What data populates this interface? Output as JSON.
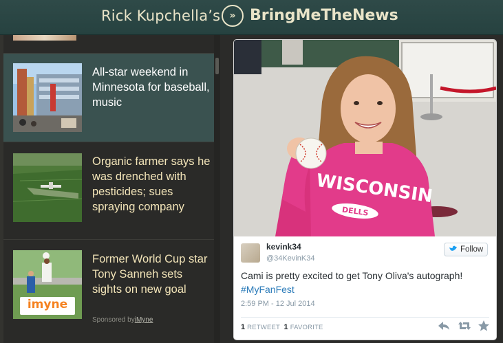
{
  "header": {
    "brand_prefix": "Rick Kupchella’s",
    "logo_glyph": "»",
    "brand_name": "BringMeTheNews"
  },
  "stories": [
    {
      "headline": "All-star weekend in Minnesota for baseball, music",
      "active": true
    },
    {
      "headline": "Organic farmer says he was drenched with pesticides; sues spraying company",
      "active": false
    },
    {
      "headline": "Former World Cup star Tony Sanneh sets sights on new goal",
      "active": false,
      "sponsored_prefix": "Sponsored by",
      "sponsor": "iMyne",
      "thumb_logo": "imyne"
    }
  ],
  "tweet": {
    "name": "kevink34",
    "handle": "@34KevinK34",
    "follow_label": "Follow",
    "text": "Cami is pretty excited to get Tony Oliva's autograph!",
    "hashtag": "#MyFanFest",
    "date": "2:59 PM - 12 Jul 2014",
    "retweets": "1",
    "retweet_label": "RETWEET",
    "favorites": "1",
    "favorite_label": "FAVORITE",
    "shirt_text": "WISCONSIN",
    "shirt_subtext": "DELLS"
  },
  "colors": {
    "header_bg": "#2b4644",
    "brand_text": "#e9e4c8",
    "active_story_bg": "#3a5250",
    "headline_text": "#f2e4b8",
    "twitter_blue": "#1da1f2",
    "shirt_pink": "#e23b8a"
  },
  "icons": [
    "logo-arrows-icon",
    "twitter-bird-icon",
    "reply-icon",
    "retweet-icon",
    "favorite-star-icon"
  ]
}
